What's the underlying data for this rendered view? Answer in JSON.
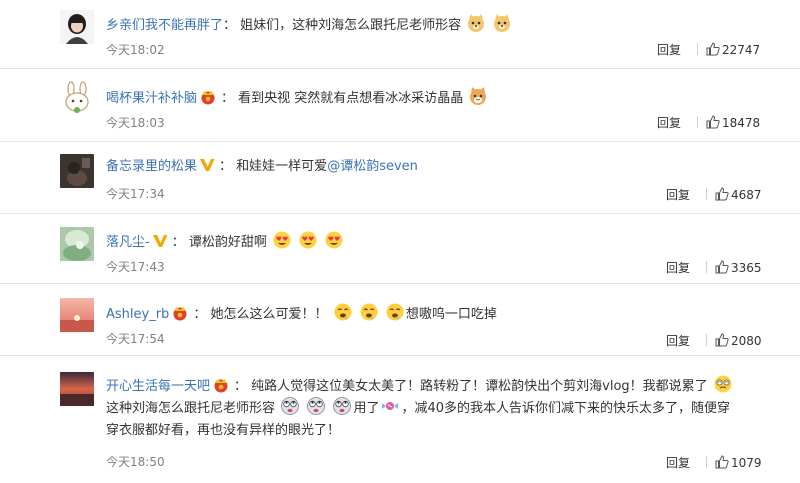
{
  "comments": [
    {
      "username": "乡亲们我不能再胖了",
      "badge": "none",
      "separator": "：",
      "text": "姐妹们，这种刘海怎么跟托尼老师形容",
      "emojis": [
        "doge-icon",
        "doge-icon"
      ],
      "time": "今天18:02",
      "reply": "回复",
      "likes": "22747"
    },
    {
      "username": "喝杯果汁补补脑",
      "badge": "crown",
      "separator": "：",
      "text": "看到央视 突然就有点想看冰冰采访晶晶",
      "emojis": [
        "cat-face-icon"
      ],
      "time": "今天18:03",
      "reply": "回复",
      "likes": "18478"
    },
    {
      "username": "备忘录里的松果",
      "badge": "verified",
      "separator": "：",
      "text": "和娃娃一样可爱",
      "mention": "@谭松韵seven",
      "time": "今天17:34",
      "reply": "回复",
      "likes": "4687"
    },
    {
      "username": "落凡尘-",
      "badge": "verified",
      "separator": "：",
      "text": "谭松韵好甜啊",
      "emojis": [
        "heart-eyes-icon",
        "heart-eyes-icon",
        "heart-eyes-icon"
      ],
      "time": "今天17:43",
      "reply": "回复",
      "likes": "3365"
    },
    {
      "username": "Ashley_rb",
      "badge": "crown",
      "separator": "：",
      "text": "她怎么这么可爱！！",
      "emojis": [
        "drool-face-icon",
        "drool-face-icon",
        "drool-face-icon"
      ],
      "text_after": "想嗷呜一口吃掉",
      "time": "今天17:54",
      "reply": "回复",
      "likes": "2080"
    },
    {
      "username": "开心生活每一天吧",
      "badge": "crown",
      "separator": "：",
      "text": "纯路人觉得这位美女太美了！路转粉了！谭松韵快出个剪刘海vlog！我都说累了",
      "line2_text": "这种刘海怎么跟托尼老师形容",
      "line2_after": "用了",
      "line2_rest": "，减40多的我本人告诉你们减下来的快乐太多了，随便穿",
      "line3": "穿衣服都好看，再也没有异样的眼光了！",
      "time": "今天18:50",
      "reply": "回复",
      "likes": "1079"
    }
  ],
  "colors": {
    "username_blue": "#3a73b8",
    "crown_red": "#e0412b",
    "crown_gold": "#f7c21b",
    "verified_gold": "#f4a700"
  }
}
